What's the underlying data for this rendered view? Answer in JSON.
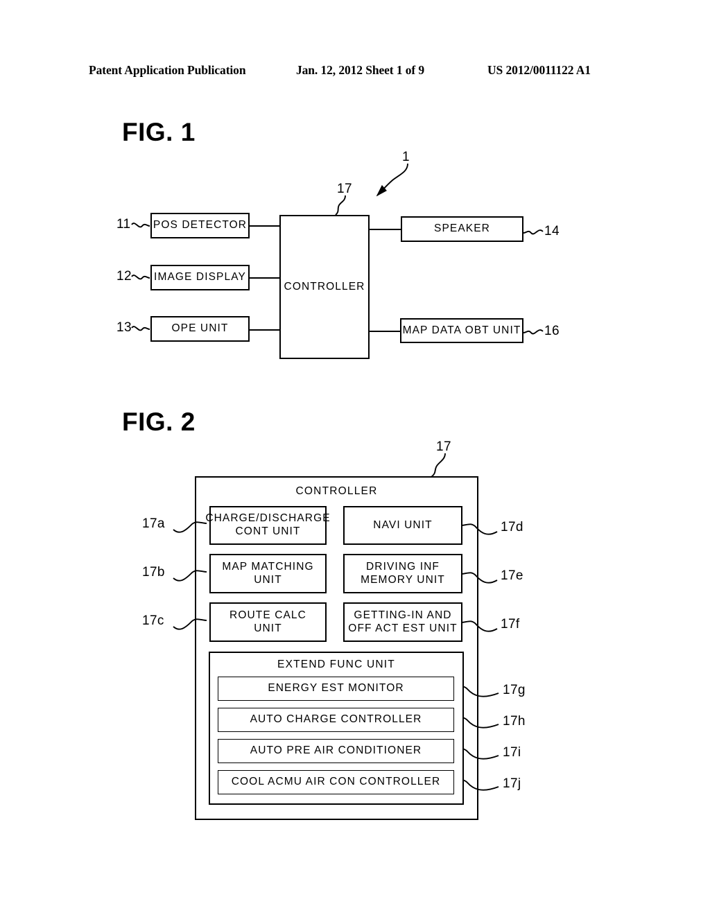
{
  "header": {
    "left": "Patent Application Publication",
    "center": "Jan. 12, 2012  Sheet 1 of 9",
    "right": "US 2012/0011122 A1"
  },
  "fig1": {
    "title": "FIG. 1",
    "system_ref": "1",
    "controller_ref": "17",
    "controller_label": "CONTROLLER",
    "left_blocks": [
      {
        "ref": "11",
        "label": "POS DETECTOR"
      },
      {
        "ref": "12",
        "label": "IMAGE DISPLAY"
      },
      {
        "ref": "13",
        "label": "OPE UNIT"
      }
    ],
    "right_blocks": [
      {
        "ref": "14",
        "label": "SPEAKER"
      },
      {
        "ref": "16",
        "label": "MAP DATA OBT UNIT"
      }
    ]
  },
  "fig2": {
    "title": "FIG. 2",
    "controller_ref": "17",
    "controller_label": "CONTROLLER",
    "left_column": [
      {
        "ref": "17a",
        "label": "CHARGE/DISCHARGE\nCONT UNIT"
      },
      {
        "ref": "17b",
        "label": "MAP MATCHING\nUNIT"
      },
      {
        "ref": "17c",
        "label": "ROUTE CALC\nUNIT"
      }
    ],
    "right_column": [
      {
        "ref": "17d",
        "label": "NAVI UNIT"
      },
      {
        "ref": "17e",
        "label": "DRIVING INF\nMEMORY UNIT"
      },
      {
        "ref": "17f",
        "label": "GETTING-IN AND\nOFF ACT EST UNIT"
      }
    ],
    "extend_func": {
      "label": "EXTEND FUNC UNIT",
      "items": [
        {
          "ref": "17g",
          "label": "ENERGY EST MONITOR"
        },
        {
          "ref": "17h",
          "label": "AUTO CHARGE CONTROLLER"
        },
        {
          "ref": "17i",
          "label": "AUTO PRE AIR CONDITIONER"
        },
        {
          "ref": "17j",
          "label": "COOL ACMU AIR CON CONTROLLER"
        }
      ]
    }
  },
  "colors": {
    "ink": "#000000",
    "paper": "#ffffff"
  }
}
